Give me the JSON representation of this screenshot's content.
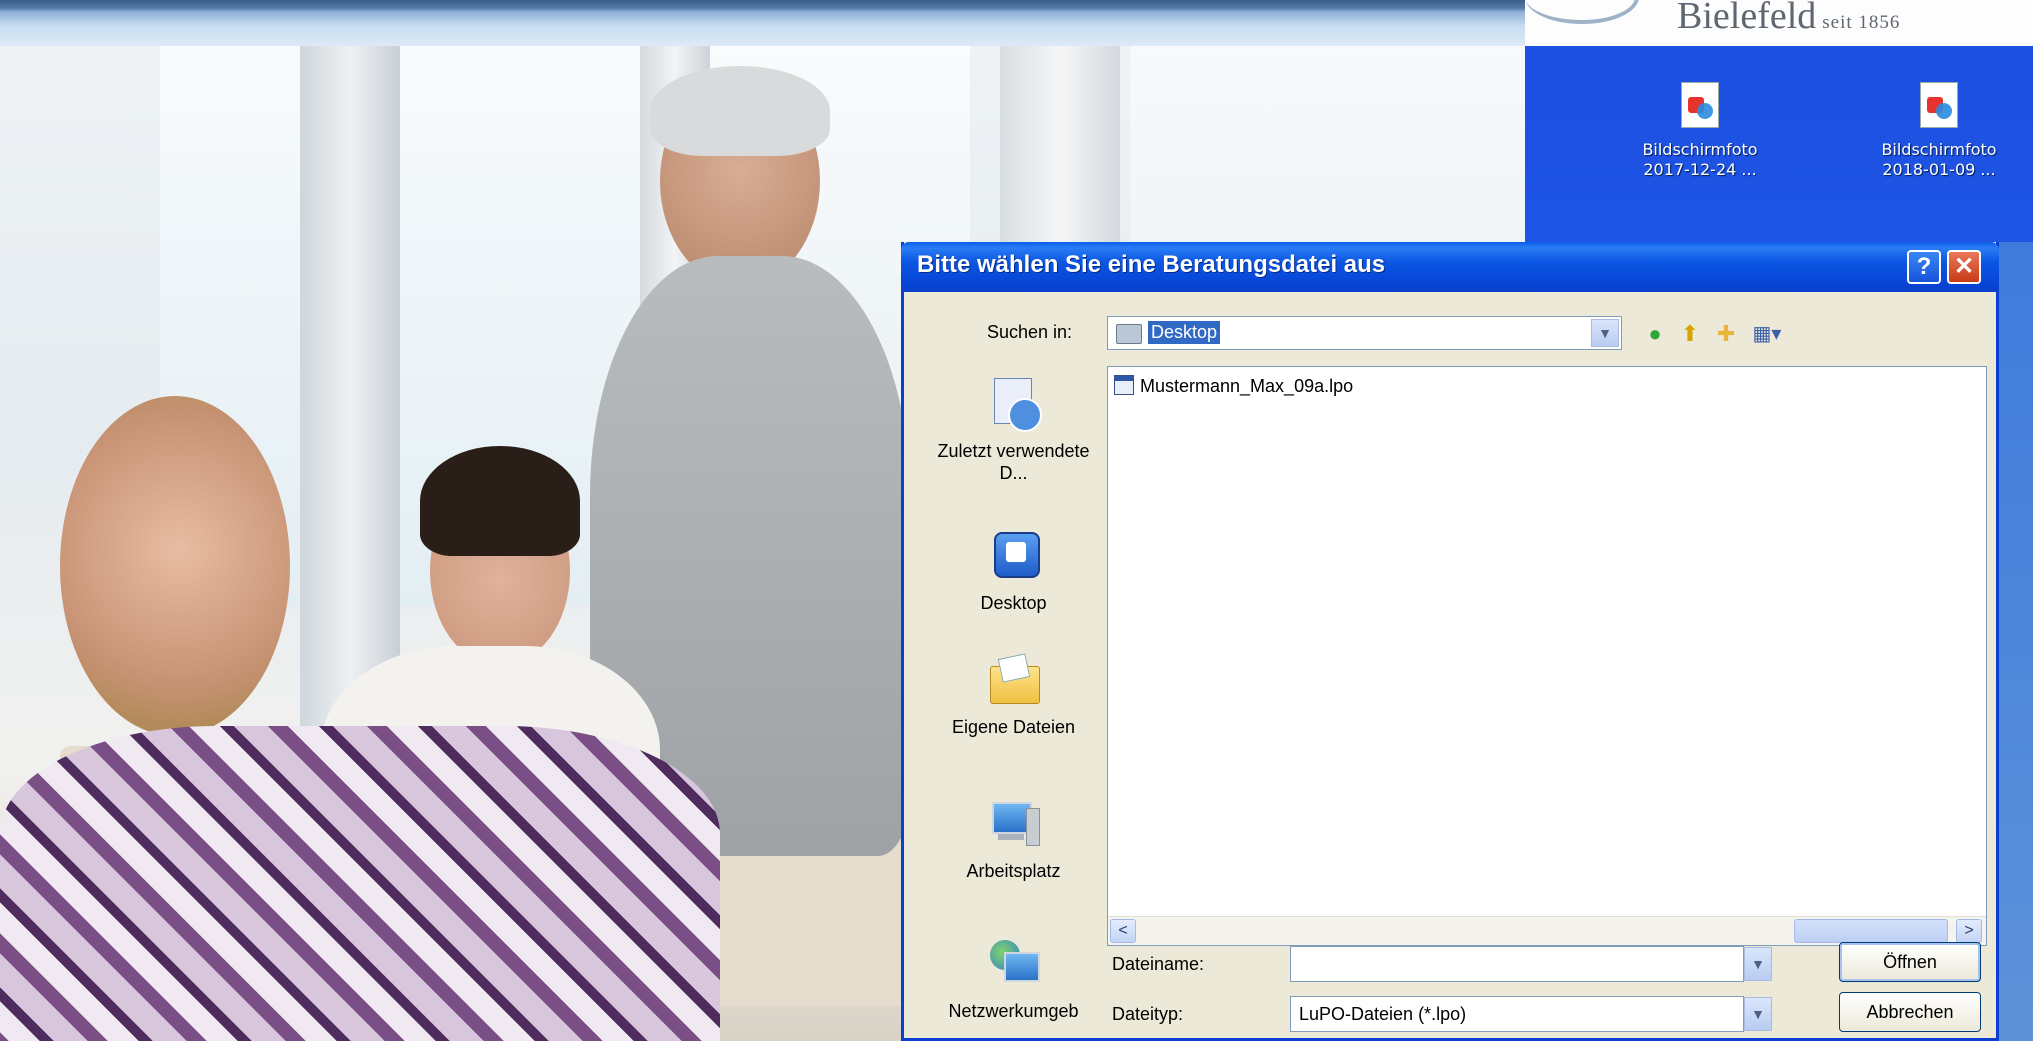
{
  "brand": {
    "name": "Bielefeld",
    "tagline": "seit 1856"
  },
  "desktop": {
    "icons": [
      {
        "name": "Bildschirmfoto",
        "date": "2017-12-24 ..."
      },
      {
        "name": "Bildschirmfoto",
        "date": "2018-01-09 ..."
      }
    ]
  },
  "dialog": {
    "title": "Bitte wählen Sie eine Beratungsdatei aus",
    "help_glyph": "?",
    "close_glyph": "✕",
    "look_in_label": "Suchen in:",
    "look_in_value": "Desktop",
    "places": [
      {
        "label": "Zuletzt verwendete D...",
        "icon": "recent-documents-icon"
      },
      {
        "label": "Desktop",
        "icon": "desktop-icon"
      },
      {
        "label": "Eigene Dateien",
        "icon": "my-documents-icon"
      },
      {
        "label": "Arbeitsplatz",
        "icon": "my-computer-icon"
      },
      {
        "label": "Netzwerkumgeb",
        "icon": "network-places-icon"
      }
    ],
    "files": [
      {
        "name": "Mustermann_Max_09a.lpo"
      }
    ],
    "filename_label": "Dateiname:",
    "filename_value": "",
    "filetype_label": "Dateityp:",
    "filetype_value": "LuPO-Dateien (*.lpo)",
    "open_label": "Öffnen",
    "cancel_label": "Abbrechen",
    "scroll_left": "<",
    "scroll_right": ">"
  }
}
